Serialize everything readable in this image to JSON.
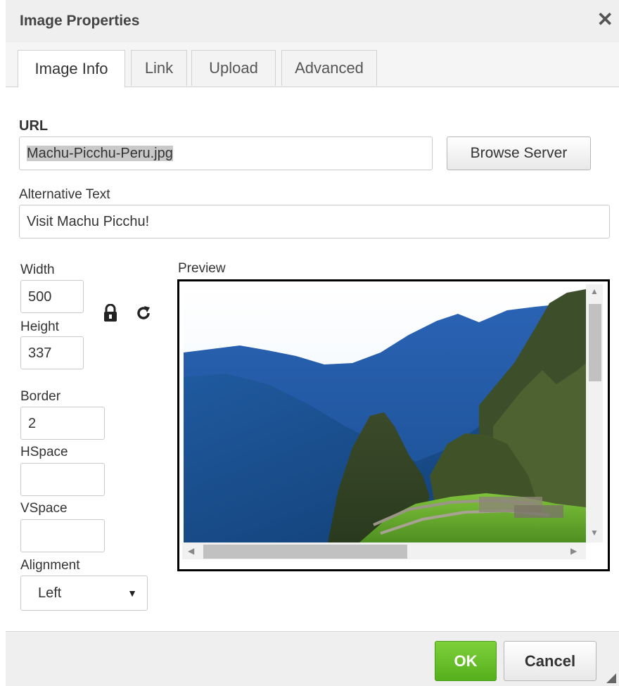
{
  "dialog": {
    "title": "Image Properties",
    "close_icon": "✕"
  },
  "tabs": [
    {
      "label": "Image Info",
      "active": true
    },
    {
      "label": "Link",
      "active": false
    },
    {
      "label": "Upload",
      "active": false
    },
    {
      "label": "Advanced",
      "active": false
    }
  ],
  "url": {
    "label": "URL",
    "value": "Machu-Picchu-Peru.jpg",
    "browse_label": "Browse Server"
  },
  "alt": {
    "label": "Alternative Text",
    "value": "Visit Machu Picchu!"
  },
  "dimensions": {
    "width_label": "Width",
    "width_value": "500",
    "height_label": "Height",
    "height_value": "337",
    "lock_icon": "lock-icon",
    "reset_icon": "reset-size-icon"
  },
  "border": {
    "label": "Border",
    "value": "2"
  },
  "hspace": {
    "label": "HSpace",
    "value": ""
  },
  "vspace": {
    "label": "VSpace",
    "value": ""
  },
  "alignment": {
    "label": "Alignment",
    "value": "Left"
  },
  "preview": {
    "label": "Preview"
  },
  "footer": {
    "ok_label": "OK",
    "cancel_label": "Cancel"
  },
  "colors": {
    "ok_green": "#5cb323",
    "preview_border": "#000000"
  }
}
